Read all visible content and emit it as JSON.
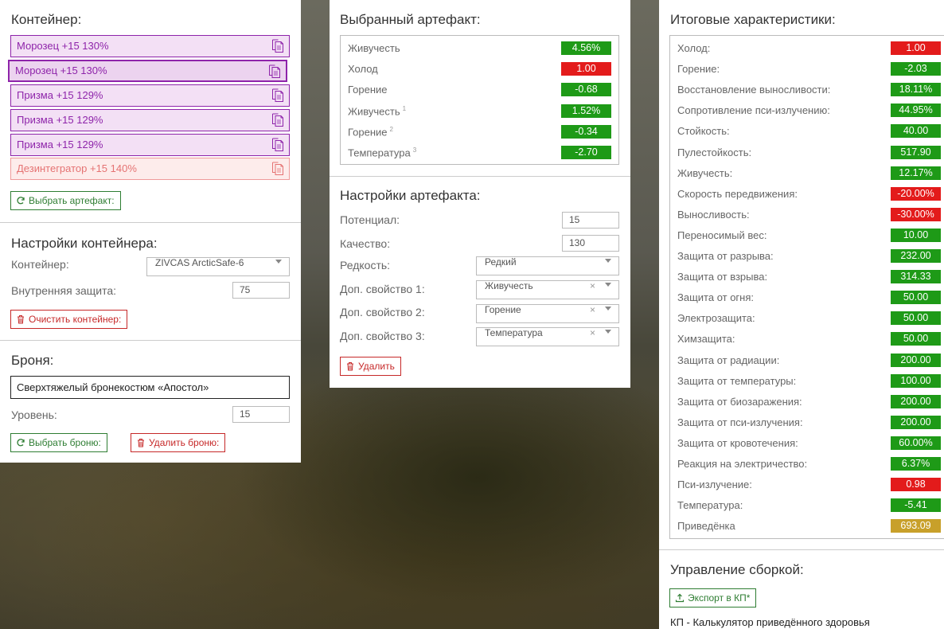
{
  "container": {
    "title": "Контейнер:",
    "items": [
      {
        "label": "Морозец +15 130%",
        "style": "normal"
      },
      {
        "label": "Морозец +15 130%",
        "style": "selected"
      },
      {
        "label": "Призма +15 129%",
        "style": "normal"
      },
      {
        "label": "Призма +15 129%",
        "style": "normal"
      },
      {
        "label": "Призма +15 129%",
        "style": "normal"
      },
      {
        "label": "Дезинтегратор +15 140%",
        "style": "red"
      }
    ],
    "select_artifact_label": "Выбрать артефакт:"
  },
  "container_settings": {
    "title": "Настройки контейнера:",
    "container_label": "Контейнер:",
    "container_value": "ZIVCAS ArcticSafe-6",
    "protection_label": "Внутренняя защита:",
    "protection_value": "75",
    "clear_label": "Очистить контейнер:"
  },
  "armor": {
    "title": "Броня:",
    "name": "Сверхтяжелый бронекостюм «Апостол»",
    "level_label": "Уровень:",
    "level_value": "15",
    "select_label": "Выбрать броню:",
    "delete_label": "Удалить броню:"
  },
  "selected_artifact": {
    "title": "Выбранный артефакт:",
    "stats": [
      {
        "name": "Живучесть",
        "sup": "",
        "value": "4.56%",
        "color": "green"
      },
      {
        "name": "Холод",
        "sup": "",
        "value": "1.00",
        "color": "red"
      },
      {
        "name": "Горение",
        "sup": "",
        "value": "-0.68",
        "color": "green"
      },
      {
        "name": "Живучесть",
        "sup": "1",
        "value": "1.52%",
        "color": "green"
      },
      {
        "name": "Горение",
        "sup": "2",
        "value": "-0.34",
        "color": "green"
      },
      {
        "name": "Температура",
        "sup": "3",
        "value": "-2.70",
        "color": "green"
      }
    ]
  },
  "artifact_settings": {
    "title": "Настройки артефакта:",
    "potential_label": "Потенциал:",
    "potential_value": "15",
    "quality_label": "Качество:",
    "quality_value": "130",
    "rarity_label": "Редкость:",
    "rarity_value": "Редкий",
    "prop1_label": "Доп. свойство 1:",
    "prop1_value": "Живучесть",
    "prop2_label": "Доп. свойство 2:",
    "prop2_value": "Горение",
    "prop3_label": "Доп. свойство 3:",
    "prop3_value": "Температура",
    "clear_glyph": "×",
    "delete_label": "Удалить"
  },
  "totals": {
    "title": "Итоговые характеристики:",
    "stats": [
      {
        "name": "Холод:",
        "value": "1.00",
        "color": "red"
      },
      {
        "name": "Горение:",
        "value": "-2.03",
        "color": "green"
      },
      {
        "name": "Восстановление выносливости:",
        "value": "18.11%",
        "color": "green"
      },
      {
        "name": "Сопротивление пси-излучению:",
        "value": "44.95%",
        "color": "green"
      },
      {
        "name": "Стойкость:",
        "value": "40.00",
        "color": "green"
      },
      {
        "name": "Пулестойкость:",
        "value": "517.90",
        "color": "green"
      },
      {
        "name": "Живучесть:",
        "value": "12.17%",
        "color": "green"
      },
      {
        "name": "Скорость передвижения:",
        "value": "-20.00%",
        "color": "red"
      },
      {
        "name": "Выносливость:",
        "value": "-30.00%",
        "color": "red"
      },
      {
        "name": "Переносимый вес:",
        "value": "10.00",
        "color": "green"
      },
      {
        "name": "Защита от разрыва:",
        "value": "232.00",
        "color": "green"
      },
      {
        "name": "Защита от взрыва:",
        "value": "314.33",
        "color": "green"
      },
      {
        "name": "Защита от огня:",
        "value": "50.00",
        "color": "green"
      },
      {
        "name": "Электрозащита:",
        "value": "50.00",
        "color": "green"
      },
      {
        "name": "Химзащита:",
        "value": "50.00",
        "color": "green"
      },
      {
        "name": "Защита от радиации:",
        "value": "200.00",
        "color": "green"
      },
      {
        "name": "Защита от температуры:",
        "value": "100.00",
        "color": "green"
      },
      {
        "name": "Защита от биозаражения:",
        "value": "200.00",
        "color": "green"
      },
      {
        "name": "Защита от пси-излучения:",
        "value": "200.00",
        "color": "green"
      },
      {
        "name": "Защита от кровотечения:",
        "value": "60.00%",
        "color": "green"
      },
      {
        "name": "Реакция на электричество:",
        "value": "6.37%",
        "color": "green"
      },
      {
        "name": "Пси-излучение:",
        "value": "0.98",
        "color": "red"
      },
      {
        "name": "Температура:",
        "value": "-5.41",
        "color": "green"
      },
      {
        "name": "Приведёнка",
        "value": "693.09",
        "color": "yellow"
      }
    ]
  },
  "build": {
    "title": "Управление сборкой:",
    "export_label": "Экспорт в КП*",
    "footnote": "КП - Калькулятор приведённого здоровья"
  },
  "colors": {
    "green": "#1e9a17",
    "red": "#e31b1b",
    "yellow": "#c8a02a",
    "purple": "#8e24aa"
  }
}
